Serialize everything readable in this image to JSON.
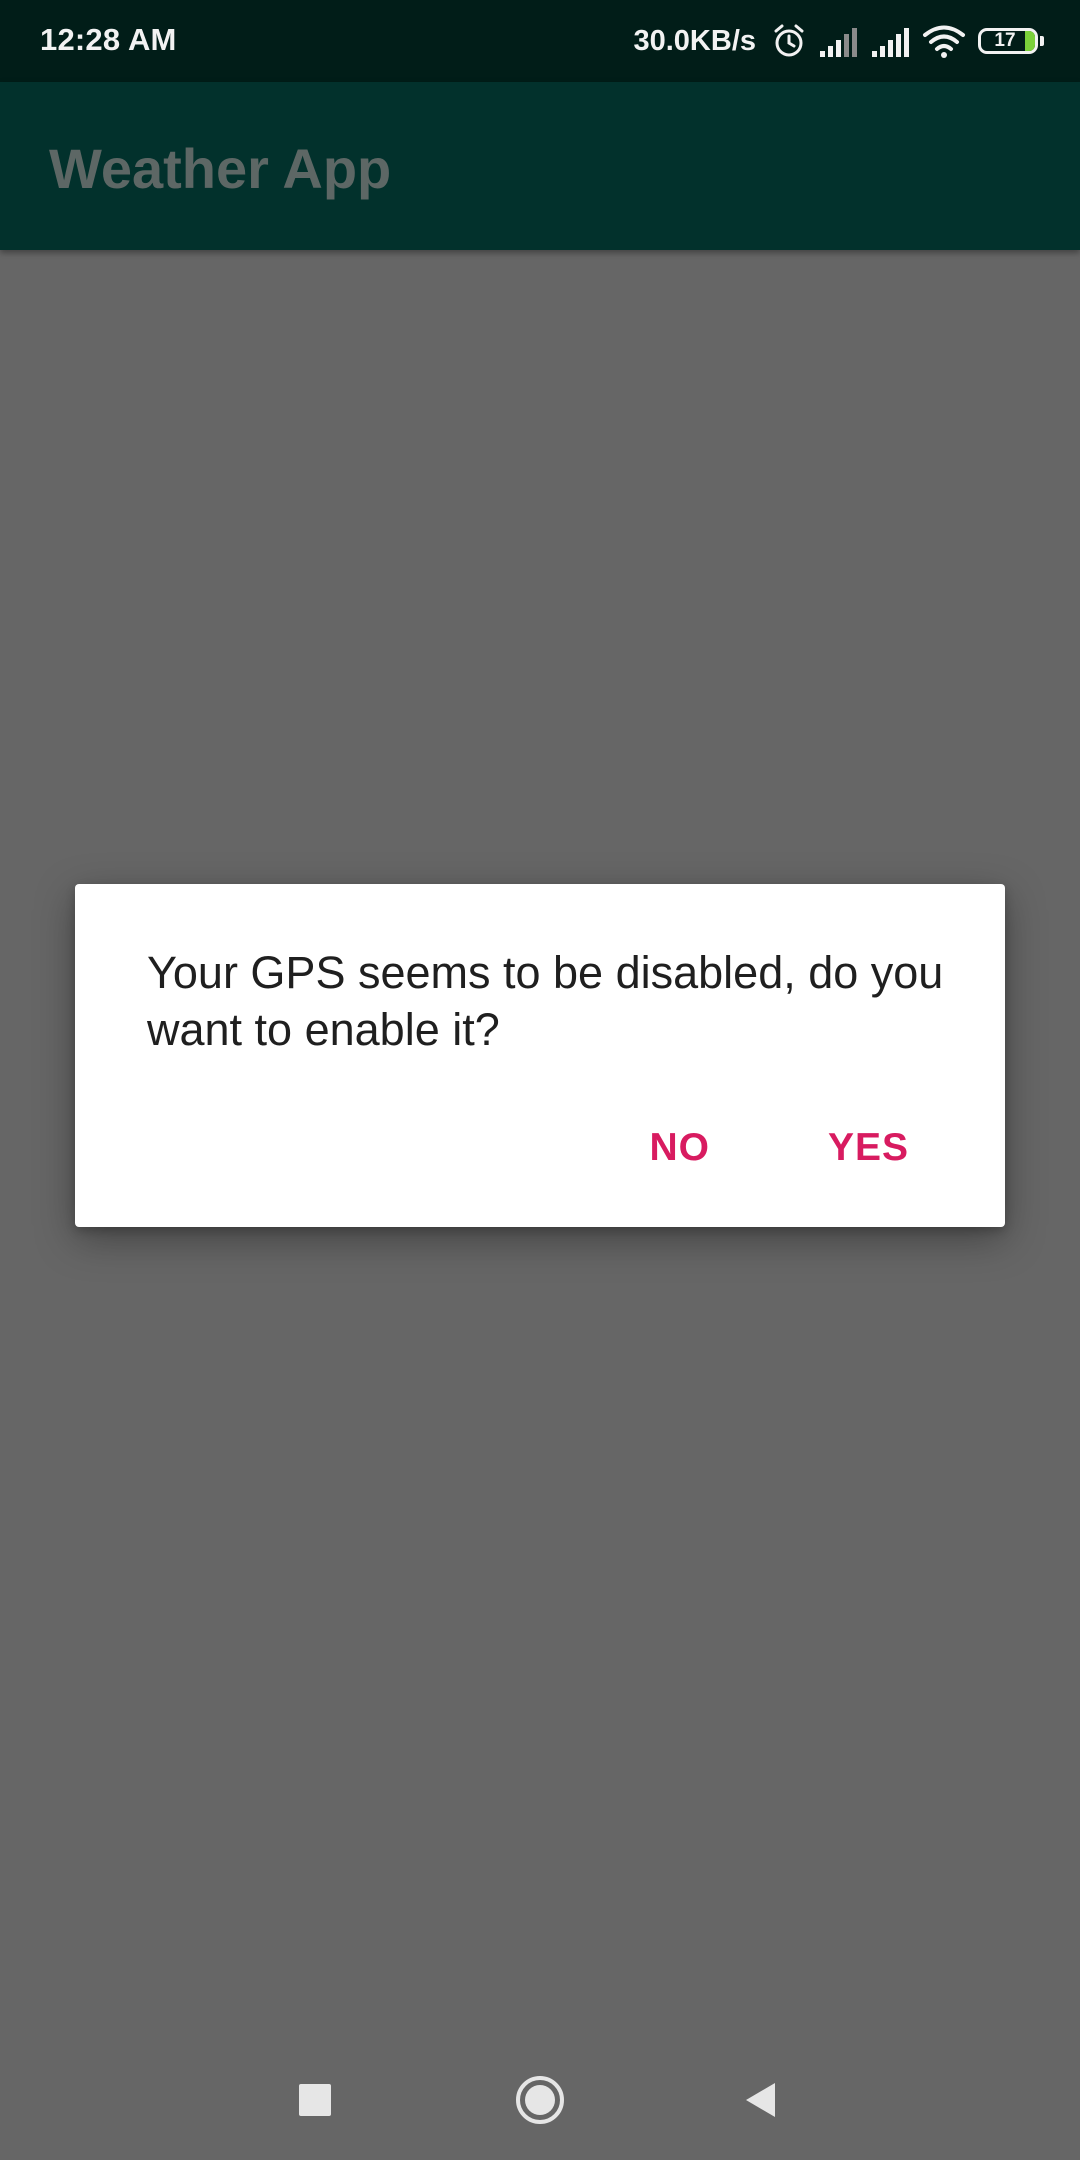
{
  "status_bar": {
    "time": "12:28 AM",
    "net_speed": "30.0KB/s",
    "icons": [
      "alarm-icon",
      "signal-icon-1",
      "signal-icon-2",
      "wifi-icon"
    ],
    "battery_level": "17",
    "battery_color": "#7bd13b"
  },
  "app_bar": {
    "title": "Weather App",
    "color": "#02312c"
  },
  "dialog": {
    "message": "Your GPS seems to be disabled, do you want to enable it?",
    "negative_label": "NO",
    "positive_label": "YES",
    "accent_color": "#d81b60"
  },
  "nav_bar": {
    "buttons": [
      "recent-apps-icon",
      "home-icon",
      "back-icon"
    ]
  }
}
